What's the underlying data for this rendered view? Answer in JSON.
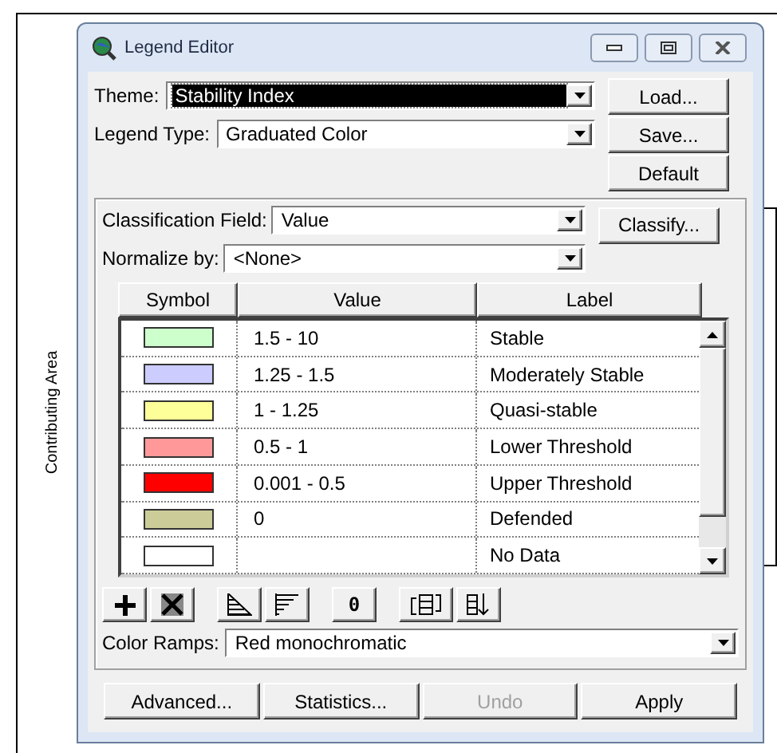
{
  "background": {
    "axis_label": "Contributing Area"
  },
  "window": {
    "title": "Legend Editor"
  },
  "theme": {
    "label": "Theme:",
    "value": "Stability Index",
    "focused": true
  },
  "legend_type": {
    "label": "Legend Type:",
    "value": "Graduated Color"
  },
  "side_buttons": [
    "Load...",
    "Save...",
    "Default"
  ],
  "classification_field": {
    "label": "Classification Field:",
    "value": "Value"
  },
  "classify_button": "Classify...",
  "normalize_by": {
    "label": "Normalize by:",
    "value": "<None>"
  },
  "table": {
    "columns": [
      "Symbol",
      "Value",
      "Label"
    ],
    "rows": [
      {
        "color": "#ccffcc",
        "value": "1.5 - 10",
        "label": "Stable"
      },
      {
        "color": "#ccccff",
        "value": "1.25 - 1.5",
        "label": "Moderately Stable"
      },
      {
        "color": "#ffff99",
        "value": "1 - 1.25",
        "label": "Quasi-stable"
      },
      {
        "color": "#ff9999",
        "value": "0.5 - 1",
        "label": "Lower Threshold"
      },
      {
        "color": "#ff0000",
        "value": "0.001 - 0.5",
        "label": "Upper Threshold"
      },
      {
        "color": "#cccc99",
        "value": "0",
        "label": "Defended"
      },
      {
        "color": "#ffffff",
        "value": "",
        "label": "No Data"
      }
    ]
  },
  "tools": [
    {
      "kind": "add"
    },
    {
      "kind": "delete"
    },
    {
      "kind": "ramp-up"
    },
    {
      "kind": "ramp-down"
    },
    {
      "kind": "text",
      "label": "0"
    },
    {
      "kind": "flip"
    },
    {
      "kind": "sort"
    }
  ],
  "color_ramps": {
    "label": "Color Ramps:",
    "value": "Red monochromatic"
  },
  "bottom_buttons": [
    {
      "label": "Advanced...",
      "disabled": false
    },
    {
      "label": "Statistics...",
      "disabled": false
    },
    {
      "label": "Undo",
      "disabled": true
    },
    {
      "label": "Apply",
      "disabled": false
    }
  ]
}
